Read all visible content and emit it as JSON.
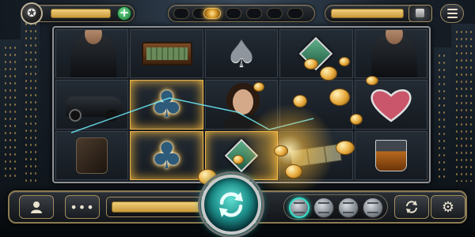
{
  "top_bar": {
    "chip_icon": "poker-chip-icon",
    "balance_bar_color": "#e6b85c",
    "add_icon": "plus-icon",
    "level_dots": {
      "count": 7,
      "active_index": 2
    },
    "menu_icon": "hamburger-menu-icon"
  },
  "reels": {
    "columns": 5,
    "rows": 3,
    "symbols": [
      [
        "gangster-fedora",
        "briefcase-of-cash",
        "spade",
        "green-diamond",
        "gangster-tommy-gun"
      ],
      [
        "vintage-car",
        "club-win",
        "lady-portrait",
        "gold-coin-burst",
        "heart"
      ],
      [
        "hip-flask",
        "club-win",
        "green-diamond-win",
        "gold-bars",
        "whiskey-glass"
      ]
    ],
    "win_positions": [
      [
        1,
        1
      ],
      [
        2,
        1
      ],
      [
        2,
        2
      ]
    ]
  },
  "bottom_bar": {
    "profile_icon": "user-icon",
    "more_icon": "more-dots-icon",
    "bet_bar_color": "#e6b85c",
    "spin_icon": "spin-arrows-icon",
    "chip_count": 4,
    "active_chip": 0,
    "autoplay_icon": "autoplay-icon",
    "settings_icon": "gear-icon"
  },
  "colors": {
    "gold": "#e6b85c",
    "accent_teal": "#1fc8b8",
    "frame": "#8c7a52"
  }
}
